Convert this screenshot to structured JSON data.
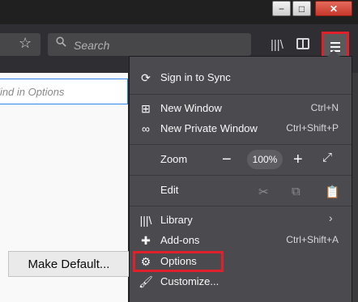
{
  "window": {
    "min": "−",
    "max": "□",
    "close": "✕"
  },
  "toolbar": {
    "search_placeholder": "Search"
  },
  "content": {
    "find_placeholder": "Find in Options",
    "make_default": "Make Default..."
  },
  "menu": {
    "sync": "Sign in to Sync",
    "new_window": {
      "label": "New Window",
      "shortcut": "Ctrl+N"
    },
    "new_private": {
      "label": "New Private Window",
      "shortcut": "Ctrl+Shift+P"
    },
    "zoom": {
      "label": "Zoom",
      "value": "100%"
    },
    "edit": "Edit",
    "library": "Library",
    "addons": {
      "label": "Add-ons",
      "shortcut": "Ctrl+Shift+A"
    },
    "options": "Options",
    "customize": "Customize..."
  },
  "colors": {
    "highlight": "#e0202a",
    "panel": "#4a4a4f",
    "accent": "#2f86e8"
  }
}
